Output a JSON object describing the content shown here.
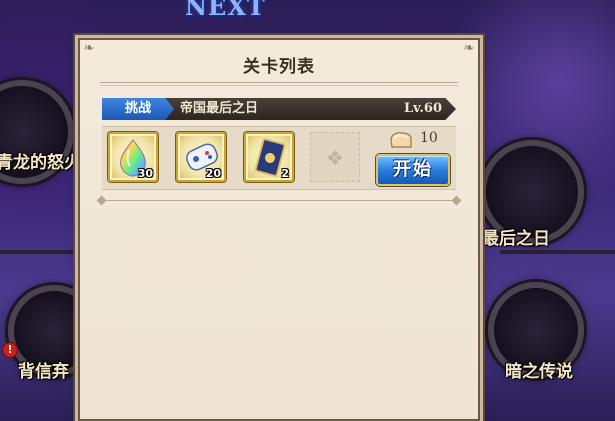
{
  "background": {
    "next_label": "NEXT",
    "nodes": [
      {
        "label": "青龙的怒火"
      },
      {
        "label": "最后之日"
      },
      {
        "label": "背信弃"
      },
      {
        "label": "暗之传说"
      }
    ],
    "alert_badge": "!"
  },
  "dialog": {
    "title": "关卡列表",
    "stage": {
      "tag": "挑战",
      "name": "帝国最后之日",
      "level": "Lv.60",
      "rewards": [
        {
          "icon": "rainbow-crystal-icon",
          "quantity": "30"
        },
        {
          "icon": "gamepad-ticket-icon",
          "quantity": "20"
        },
        {
          "icon": "card-icon",
          "quantity": "2"
        }
      ],
      "stamina_icon": "bread-icon",
      "stamina_cost": "10",
      "start_label": "开始"
    }
  },
  "colors": {
    "challenge_tag": "#2a6fd0",
    "start_button": "#2b7ede",
    "panel": "#f0e6d6"
  }
}
